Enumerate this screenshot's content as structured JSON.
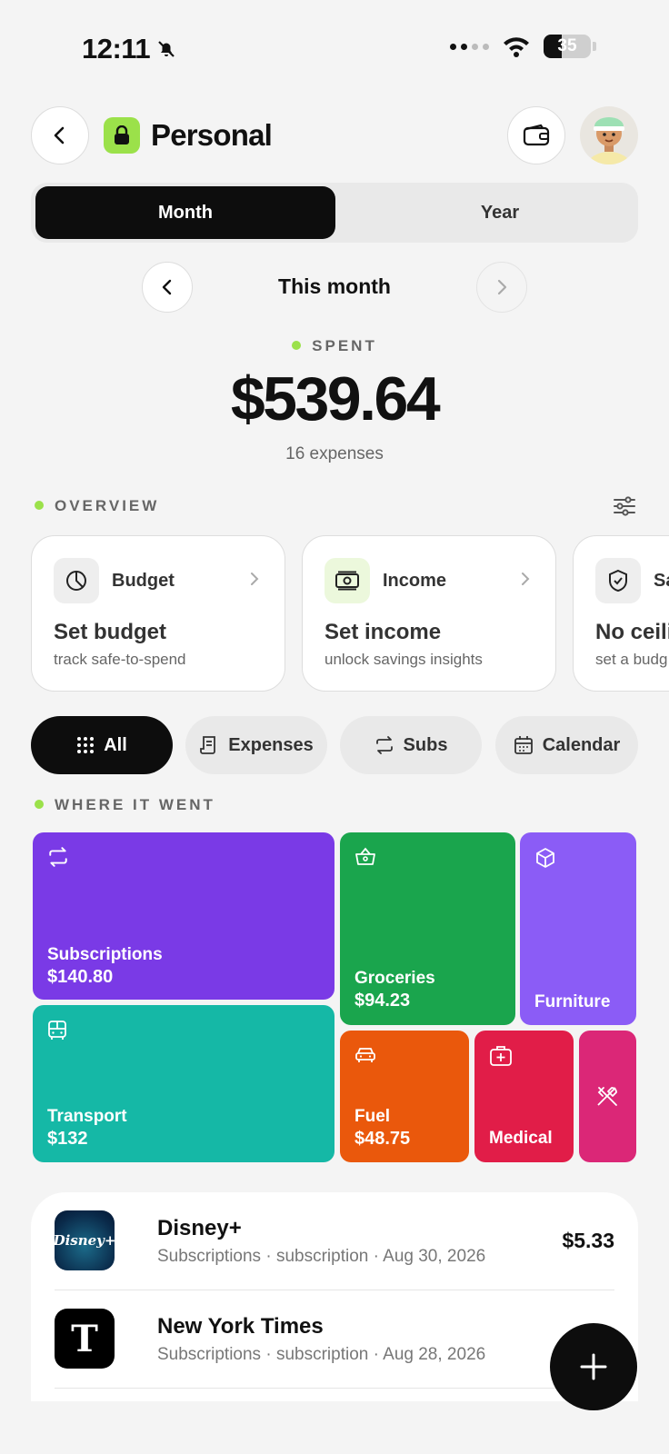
{
  "status_bar": {
    "time": "12:11",
    "battery": "35"
  },
  "header": {
    "title": "Personal"
  },
  "period_toggle": {
    "options": [
      "Month",
      "Year"
    ],
    "selected": "Month"
  },
  "period_nav": {
    "label": "This month"
  },
  "summary": {
    "label": "SPENT",
    "amount": "$539.64",
    "count": "16 expenses"
  },
  "overview": {
    "label": "OVERVIEW",
    "cards": [
      {
        "name": "Budget",
        "title": "Set budget",
        "subtitle": "track safe-to-spend",
        "icon": "pie-chart-icon"
      },
      {
        "name": "Income",
        "title": "Set income",
        "subtitle": "unlock savings insights",
        "icon": "banknote-icon"
      },
      {
        "name": "Sa",
        "title": "No ceili",
        "subtitle": "set a budg",
        "icon": "shield-check-icon"
      }
    ]
  },
  "filters": [
    {
      "label": "All",
      "icon": "grid-icon",
      "active": true
    },
    {
      "label": "Expenses",
      "icon": "receipt-icon",
      "active": false
    },
    {
      "label": "Subs",
      "icon": "repeat-icon",
      "active": false
    },
    {
      "label": "Calendar",
      "icon": "calendar-icon",
      "active": false
    }
  ],
  "where_it_went": {
    "label": "WHERE IT WENT",
    "categories": [
      {
        "name": "Subscriptions",
        "amount": "$140.80",
        "color": "#7a3ae6",
        "icon": "repeat-icon"
      },
      {
        "name": "Groceries",
        "amount": "$94.23",
        "color": "#1aa54d",
        "icon": "basket-icon"
      },
      {
        "name": "Furniture",
        "amount": "",
        "color": "#8b5cf6",
        "icon": "box-icon"
      },
      {
        "name": "Transport",
        "amount": "$132",
        "color": "#15b8a6",
        "icon": "bus-icon"
      },
      {
        "name": "Fuel",
        "amount": "$48.75",
        "color": "#ea580c",
        "icon": "car-icon"
      },
      {
        "name": "Medical",
        "amount": "",
        "color": "#e11d48",
        "icon": "medical-kit-icon"
      },
      {
        "name": "",
        "amount": "",
        "color": "#db2777",
        "icon": "utensils-icon"
      }
    ]
  },
  "transactions": [
    {
      "name": "Disney+",
      "meta": "Subscriptions · subscription · Aug 30, 2026",
      "amount": "$5.33",
      "logo_text": "Disney+"
    },
    {
      "name": "New York Times",
      "meta": "Subscriptions · subscription · Aug 28, 2026",
      "amount": "",
      "logo_text": "T"
    }
  ]
}
